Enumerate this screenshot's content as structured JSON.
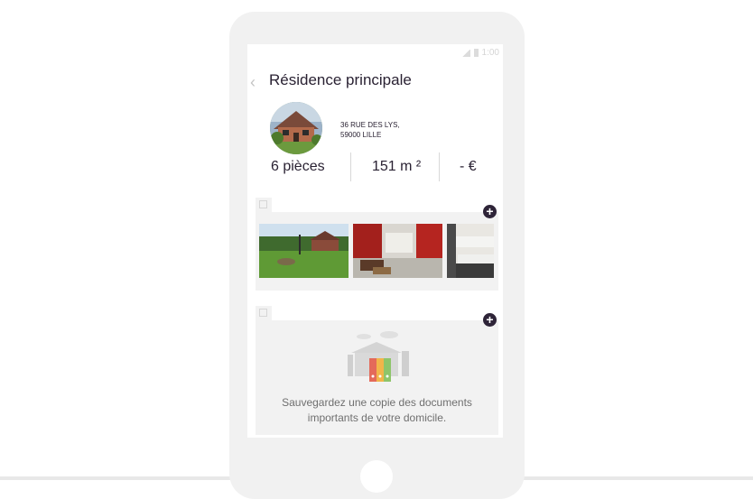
{
  "page": {
    "title": "Résidence principale",
    "address_line1": "36 RUE DES LYS,",
    "address_line2": "59000 LILLE"
  },
  "status_bar": {
    "time": "1:00"
  },
  "stats": {
    "rooms": "6 pièces",
    "area": "151 m ²",
    "price": "- €"
  },
  "photos": {
    "items": [
      {
        "name": "garden-photo",
        "alt": "Jardin"
      },
      {
        "name": "living-room-photo",
        "alt": "Salon"
      },
      {
        "name": "kitchen-photo",
        "alt": "Cuisine"
      }
    ]
  },
  "documents": {
    "empty_line1": "Sauvegardez une copie des documents",
    "empty_line2": "importants de votre domicile."
  },
  "colors": {
    "accent": "#2e2438",
    "section_bg": "#f2f2f2",
    "phone_frame": "#f1f1f1"
  }
}
